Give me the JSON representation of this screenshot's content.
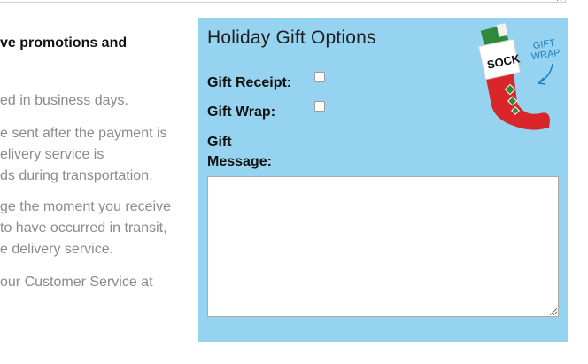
{
  "promo_text": "ve promotions and",
  "paragraphs": [
    {
      "lines": [
        "ed in business days."
      ]
    },
    {
      "lines": [
        "e sent after the payment is",
        "elivery service is",
        "ds during transportation."
      ]
    },
    {
      "lines": [
        "ge the moment you receive",
        " to have occurred in transit,",
        "e delivery service."
      ]
    },
    {
      "lines": [
        " our Customer Service at"
      ]
    }
  ],
  "gift": {
    "title": "Holiday Gift Options",
    "receipt_label": "Gift Receipt:",
    "receipt_checked": false,
    "wrap_label": "Gift Wrap:",
    "wrap_checked": false,
    "message_label_line1": "Gift",
    "message_label_line2": "Message:",
    "message_value": "",
    "image_text": [
      "SOCK",
      "GIFT",
      "WRAP"
    ]
  },
  "colors": {
    "panel_bg": "#95d3f0",
    "stocking_red": "#d8262b",
    "arrow_blue": "#1e7fc1"
  }
}
